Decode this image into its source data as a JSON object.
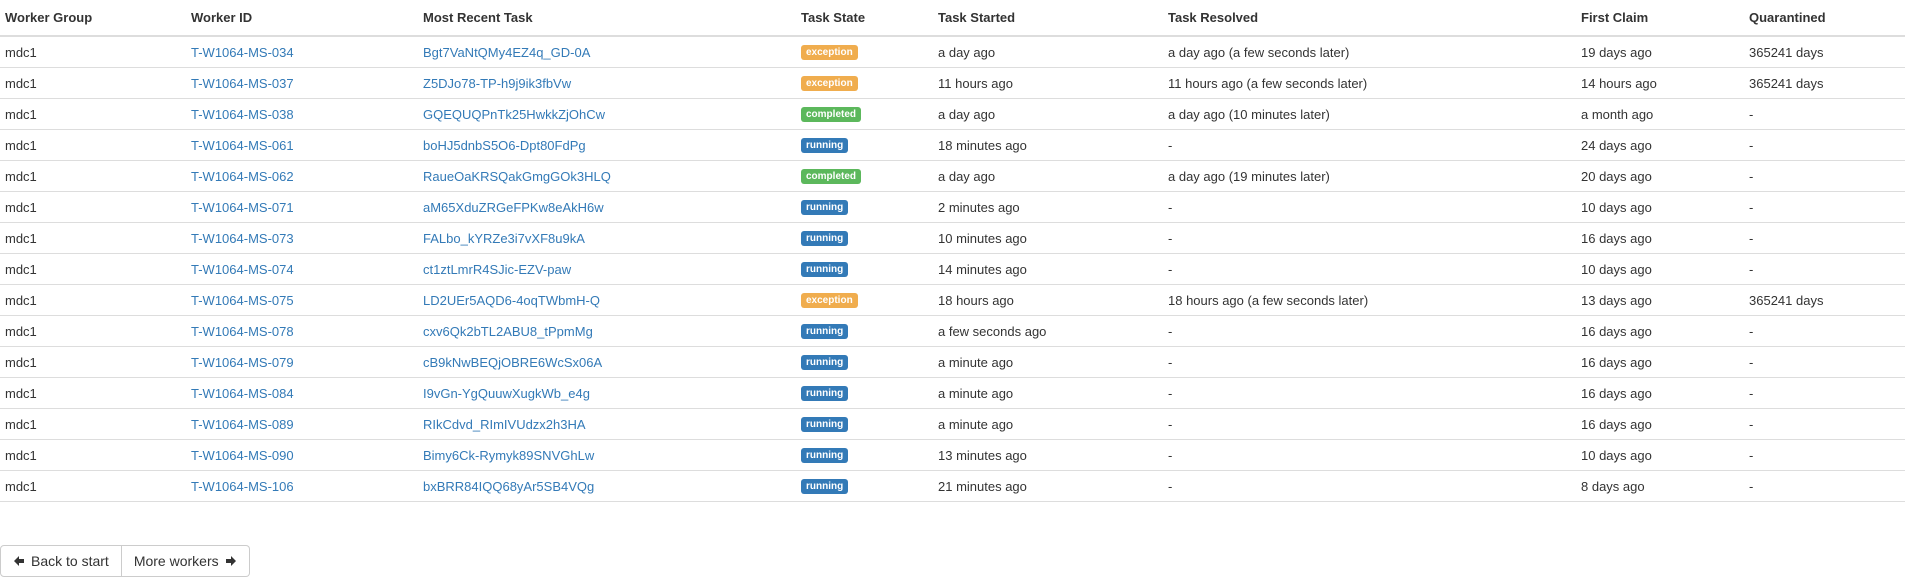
{
  "table": {
    "headers": [
      "Worker Group",
      "Worker ID",
      "Most Recent Task",
      "Task State",
      "Task Started",
      "Task Resolved",
      "First Claim",
      "Quarantined"
    ],
    "rows": [
      {
        "group": "mdc1",
        "worker_id": "T-W1064-MS-034",
        "task": "Bgt7VaNtQMy4EZ4q_GD-0A",
        "state": "exception",
        "started": "a day ago",
        "resolved": "a day ago (a few seconds later)",
        "first_claim": "19 days ago",
        "quarantined": "365241 days"
      },
      {
        "group": "mdc1",
        "worker_id": "T-W1064-MS-037",
        "task": "Z5DJo78-TP-h9j9ik3fbVw",
        "state": "exception",
        "started": "11 hours ago",
        "resolved": "11 hours ago (a few seconds later)",
        "first_claim": "14 hours ago",
        "quarantined": "365241 days"
      },
      {
        "group": "mdc1",
        "worker_id": "T-W1064-MS-038",
        "task": "GQEQUQPnTk25HwkkZjOhCw",
        "state": "completed",
        "started": "a day ago",
        "resolved": "a day ago (10 minutes later)",
        "first_claim": "a month ago",
        "quarantined": "-"
      },
      {
        "group": "mdc1",
        "worker_id": "T-W1064-MS-061",
        "task": "boHJ5dnbS5O6-Dpt80FdPg",
        "state": "running",
        "started": "18 minutes ago",
        "resolved": "-",
        "first_claim": "24 days ago",
        "quarantined": "-"
      },
      {
        "group": "mdc1",
        "worker_id": "T-W1064-MS-062",
        "task": "RaueOaKRSQakGmgGOk3HLQ",
        "state": "completed",
        "started": "a day ago",
        "resolved": "a day ago (19 minutes later)",
        "first_claim": "20 days ago",
        "quarantined": "-"
      },
      {
        "group": "mdc1",
        "worker_id": "T-W1064-MS-071",
        "task": "aM65XduZRGeFPKw8eAkH6w",
        "state": "running",
        "started": "2 minutes ago",
        "resolved": "-",
        "first_claim": "10 days ago",
        "quarantined": "-"
      },
      {
        "group": "mdc1",
        "worker_id": "T-W1064-MS-073",
        "task": "FALbo_kYRZe3i7vXF8u9kA",
        "state": "running",
        "started": "10 minutes ago",
        "resolved": "-",
        "first_claim": "16 days ago",
        "quarantined": "-"
      },
      {
        "group": "mdc1",
        "worker_id": "T-W1064-MS-074",
        "task": "ct1ztLmrR4SJic-EZV-paw",
        "state": "running",
        "started": "14 minutes ago",
        "resolved": "-",
        "first_claim": "10 days ago",
        "quarantined": "-"
      },
      {
        "group": "mdc1",
        "worker_id": "T-W1064-MS-075",
        "task": "LD2UEr5AQD6-4oqTWbmH-Q",
        "state": "exception",
        "started": "18 hours ago",
        "resolved": "18 hours ago (a few seconds later)",
        "first_claim": "13 days ago",
        "quarantined": "365241 days"
      },
      {
        "group": "mdc1",
        "worker_id": "T-W1064-MS-078",
        "task": "cxv6Qk2bTL2ABU8_tPpmMg",
        "state": "running",
        "started": "a few seconds ago",
        "resolved": "-",
        "first_claim": "16 days ago",
        "quarantined": "-"
      },
      {
        "group": "mdc1",
        "worker_id": "T-W1064-MS-079",
        "task": "cB9kNwBEQjOBRE6WcSx06A",
        "state": "running",
        "started": "a minute ago",
        "resolved": "-",
        "first_claim": "16 days ago",
        "quarantined": "-"
      },
      {
        "group": "mdc1",
        "worker_id": "T-W1064-MS-084",
        "task": "I9vGn-YgQuuwXugkWb_e4g",
        "state": "running",
        "started": "a minute ago",
        "resolved": "-",
        "first_claim": "16 days ago",
        "quarantined": "-"
      },
      {
        "group": "mdc1",
        "worker_id": "T-W1064-MS-089",
        "task": "RIkCdvd_RImIVUdzx2h3HA",
        "state": "running",
        "started": "a minute ago",
        "resolved": "-",
        "first_claim": "16 days ago",
        "quarantined": "-"
      },
      {
        "group": "mdc1",
        "worker_id": "T-W1064-MS-090",
        "task": "Bimy6Ck-Rymyk89SNVGhLw",
        "state": "running",
        "started": "13 minutes ago",
        "resolved": "-",
        "first_claim": "10 days ago",
        "quarantined": "-"
      },
      {
        "group": "mdc1",
        "worker_id": "T-W1064-MS-106",
        "task": "bxBRR84IQQ68yAr5SB4VQg",
        "state": "running",
        "started": "21 minutes ago",
        "resolved": "-",
        "first_claim": "8 days ago",
        "quarantined": "-"
      }
    ]
  },
  "state_colors": {
    "exception": "#f0ad4e",
    "completed": "#5cb85c",
    "running": "#337ab7"
  },
  "link_color": "#337ab7",
  "pager": {
    "back_label": "Back to start",
    "back_icon": "arrow-left-icon",
    "more_label": "More workers",
    "more_icon": "arrow-right-icon"
  }
}
